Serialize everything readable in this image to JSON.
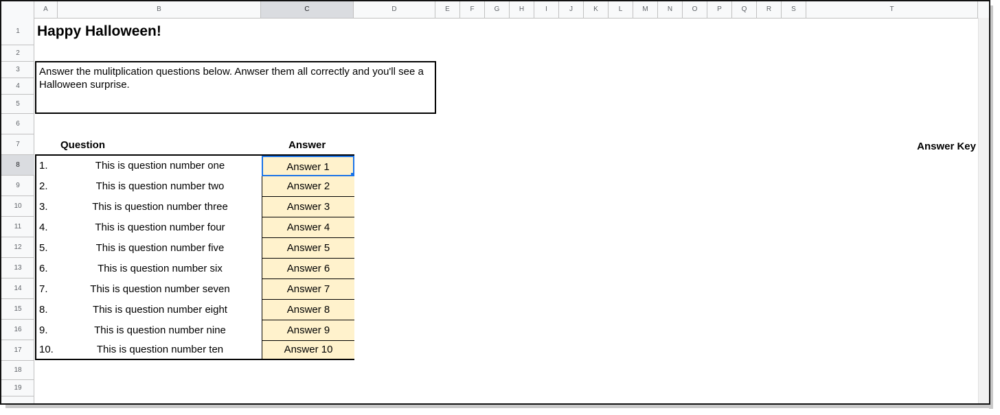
{
  "columns": [
    "A",
    "B",
    "C",
    "D",
    "E",
    "F",
    "G",
    "H",
    "I",
    "J",
    "K",
    "L",
    "M",
    "N",
    "O",
    "P",
    "Q",
    "R",
    "S",
    "T"
  ],
  "rows": [
    "1",
    "2",
    "3",
    "4",
    "5",
    "6",
    "7",
    "8",
    "9",
    "10",
    "11",
    "12",
    "13",
    "14",
    "15",
    "16",
    "17",
    "18",
    "19"
  ],
  "selected_column": "C",
  "selected_row": "8",
  "sheet": {
    "title": "Happy Halloween!",
    "instructions": "Answer the mulitplication questions below. Anwser them all correctly and you'll see a Halloween surprise.",
    "question_header": "Question",
    "answer_header": "Answer",
    "answer_key_header": "Answer Key",
    "questions": [
      {
        "num": "1.",
        "text": "This is question number one",
        "answer": "Answer 1"
      },
      {
        "num": "2.",
        "text": "This is question number two",
        "answer": "Answer 2"
      },
      {
        "num": "3.",
        "text": "This is question number three",
        "answer": "Answer 3"
      },
      {
        "num": "4.",
        "text": "This is question number four",
        "answer": "Answer 4"
      },
      {
        "num": "5.",
        "text": "This is question number five",
        "answer": "Answer 5"
      },
      {
        "num": "6.",
        "text": "This is question number six",
        "answer": "Answer 6"
      },
      {
        "num": "7.",
        "text": "This is question number seven",
        "answer": "Answer 7"
      },
      {
        "num": "8.",
        "text": "This is question number eight",
        "answer": "Answer 8"
      },
      {
        "num": "9.",
        "text": "This is question number nine",
        "answer": "Answer 9"
      },
      {
        "num": "10.",
        "text": "This is question number ten",
        "answer": "Answer 10"
      }
    ]
  },
  "colors": {
    "answer_fill": "#fff2cc",
    "selection": "#1a73e8",
    "header_bg": "#f8f9fa"
  }
}
